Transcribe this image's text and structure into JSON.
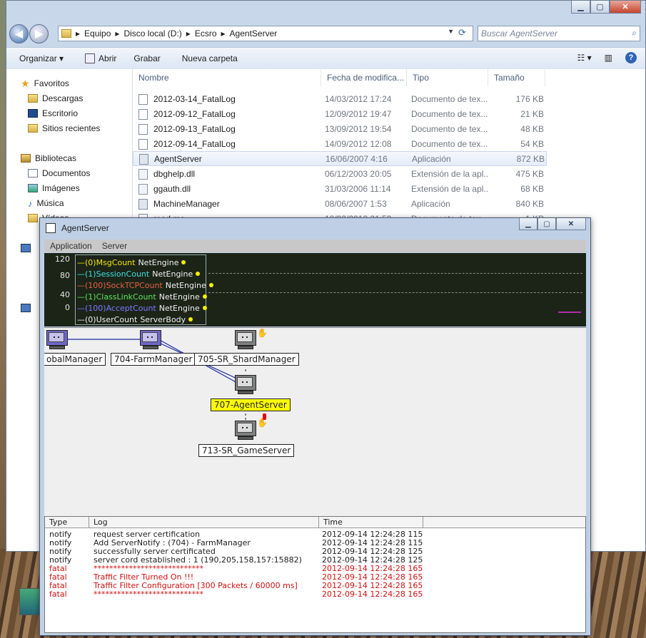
{
  "explorer": {
    "address": [
      "Equipo",
      "Disco local (D:)",
      "Ecsro",
      "AgentServer"
    ],
    "search_placeholder": "Buscar AgentServer",
    "toolbar": {
      "organize": "Organizar",
      "open": "Abrir",
      "burn": "Grabar",
      "new_folder": "Nueva carpeta"
    },
    "nav": {
      "favorites": "Favoritos",
      "downloads": "Descargas",
      "desktop": "Escritorio",
      "recent": "Sitios recientes",
      "libraries": "Bibliotecas",
      "documents": "Documentos",
      "images": "Imágenes",
      "music": "Música",
      "videos": "Vídeos"
    },
    "columns": {
      "name": "Nombre",
      "date": "Fecha de modifica...",
      "type": "Tipo",
      "size": "Tamaño"
    },
    "files": [
      {
        "name": "2012-03-14_FatalLog",
        "date": "14/03/2012 17:24",
        "type": "Documento de tex...",
        "size": "176 KB"
      },
      {
        "name": "2012-09-12_FatalLog",
        "date": "12/09/2012 19:47",
        "type": "Documento de tex...",
        "size": "21 KB"
      },
      {
        "name": "2012-09-13_FatalLog",
        "date": "13/09/2012 19:54",
        "type": "Documento de tex...",
        "size": "48 KB"
      },
      {
        "name": "2012-09-14_FatalLog",
        "date": "14/09/2012 12:08",
        "type": "Documento de tex...",
        "size": "54 KB"
      },
      {
        "name": "AgentServer",
        "date": "16/06/2007 4:16",
        "type": "Aplicación",
        "size": "872 KB"
      },
      {
        "name": "dbghelp.dll",
        "date": "06/12/2003 20:05",
        "type": "Extensión de la apl...",
        "size": "475 KB"
      },
      {
        "name": "ggauth.dll",
        "date": "31/03/2006 11:14",
        "type": "Extensión de la apl...",
        "size": "68 KB"
      },
      {
        "name": "MachineManager",
        "date": "08/06/2007 1:53",
        "type": "Aplicación",
        "size": "840 KB"
      },
      {
        "name": "read.me",
        "date": "18/03/2012 21:59",
        "type": "Documento de tex...",
        "size": "1 KB"
      }
    ]
  },
  "agent": {
    "title": "AgentServer",
    "menu": {
      "application": "Application",
      "server": "Server"
    },
    "graph": {
      "y_ticks": [
        "120",
        "80",
        "40",
        "0"
      ],
      "legend": [
        {
          "label": "(0)MsgCount",
          "node": "NetEngine",
          "color": "#f2e600"
        },
        {
          "label": "(1)SessionCount",
          "node": "NetEngine",
          "color": "#3fe0e0"
        },
        {
          "label": "(100)SockTCPCount",
          "node": "NetEngine",
          "color": "#e86040"
        },
        {
          "label": "(1)ClassLinkCount",
          "node": "NetEngine",
          "color": "#58e858"
        },
        {
          "label": "(100)AcceptCount",
          "node": "NetEngine",
          "color": "#7a7aff"
        },
        {
          "label": "(0)UserCount",
          "node": "ServerBody",
          "color": "#f0f0f0"
        }
      ]
    },
    "nodes": {
      "global": "obalManager",
      "farm": "704-FarmManager",
      "shard": "705-SR_ShardManager",
      "agent": "707-AgentServer",
      "game": "713-SR_GameServer"
    },
    "log": {
      "columns": {
        "type": "Type",
        "log": "Log",
        "time": "Time"
      },
      "rows": [
        {
          "type": "notify",
          "log": "request server certification",
          "time": "2012-09-14 12:24:28 115",
          "level": "notify"
        },
        {
          "type": "notify",
          "log": "Add ServerNotify : (704) - FarmManager",
          "time": "2012-09-14 12:24:28 115",
          "level": "notify"
        },
        {
          "type": "notify",
          "log": "successfully server certificated",
          "time": "2012-09-14 12:24:28 125",
          "level": "notify"
        },
        {
          "type": "notify",
          "log": "server cord established : 1 (190,205,158,157:15882)",
          "time": "2012-09-14 12:24:28 125",
          "level": "notify"
        },
        {
          "type": "fatal",
          "log": "****************************",
          "time": "2012-09-14 12:24:28 165",
          "level": "fatal"
        },
        {
          "type": "fatal",
          "log": "Traffic Filter Turned On !!!",
          "time": "2012-09-14 12:24:28 165",
          "level": "fatal"
        },
        {
          "type": "fatal",
          "log": "Traffic Filter Configuration [300 Packets / 60000 ms]",
          "time": "2012-09-14 12:24:28 165",
          "level": "fatal"
        },
        {
          "type": "fatal",
          "log": "****************************",
          "time": "2012-09-14 12:24:28 165",
          "level": "fatal"
        }
      ]
    }
  }
}
